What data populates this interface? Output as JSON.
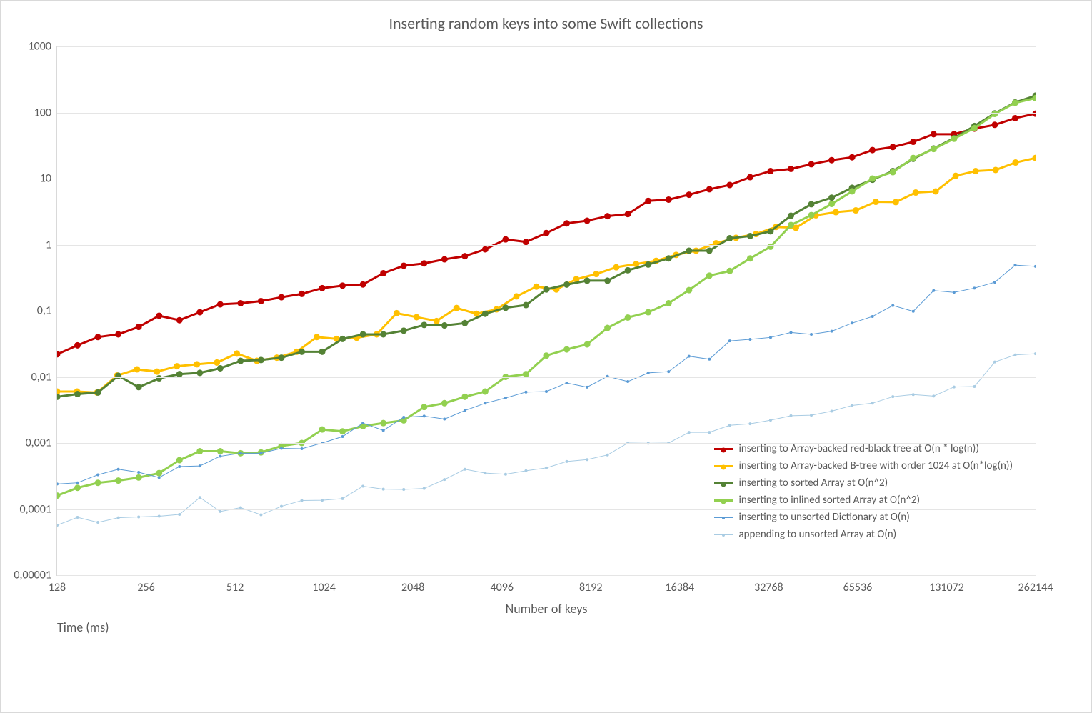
{
  "chart_data": {
    "type": "line",
    "title": "Inserting random keys into some Swift collections",
    "xlabel": "Number of keys",
    "ylabel": "Time (ms)",
    "x_scale": "log2",
    "y_scale": "log10",
    "x_ticks": [
      128,
      256,
      512,
      1024,
      2048,
      4096,
      8192,
      16384,
      32768,
      65536,
      131072,
      262144
    ],
    "y_ticks_values": [
      1e-05,
      0.0001,
      0.001,
      0.01,
      0.1,
      1,
      10,
      100,
      1000
    ],
    "y_ticks_labels": [
      "0,00001",
      "0,0001",
      "0,001",
      "0,01",
      "0,1",
      "1",
      "10",
      "100",
      "1000"
    ],
    "ylim": [
      1e-05,
      1000
    ],
    "xlim": [
      128,
      262144
    ],
    "legend_position": "inside-bottom-right",
    "series": [
      {
        "name": "inserting to Array-backed red-black tree at O(n * log(n))",
        "color": "#C00000",
        "weight": 3,
        "values": [
          0.022,
          0.03,
          0.04,
          0.044,
          0.057,
          0.084,
          0.072,
          0.095,
          0.125,
          0.13,
          0.14,
          0.16,
          0.18,
          0.22,
          0.24,
          0.25,
          0.37,
          0.48,
          0.52,
          0.6,
          0.67,
          0.85,
          1.2,
          1.1,
          1.5,
          2.1,
          2.3,
          2.7,
          2.9,
          4.6,
          4.8,
          5.7,
          6.9,
          8.0,
          10.5,
          13.0,
          14.0,
          16.5,
          19,
          21,
          27,
          30,
          36,
          47,
          47,
          57,
          65,
          82,
          96
        ]
      },
      {
        "name": "inserting to Array-backed B-tree with order 1024 at O(n*log(n))",
        "color": "#FFC000",
        "weight": 3,
        "values": [
          0.006,
          0.006,
          0.0058,
          0.0105,
          0.013,
          0.012,
          0.0145,
          0.0155,
          0.0165,
          0.0225,
          0.0175,
          0.0195,
          0.024,
          0.04,
          0.0375,
          0.039,
          0.044,
          0.092,
          0.08,
          0.07,
          0.11,
          0.09,
          0.105,
          0.165,
          0.232,
          0.21,
          0.3,
          0.36,
          0.455,
          0.51,
          0.57,
          0.7,
          0.81,
          1.05,
          1.27,
          1.45,
          1.85,
          1.8,
          2.78,
          3.1,
          3.3,
          4.45,
          4.41,
          6.15,
          6.39,
          11.0,
          13.0,
          13.5,
          17.5,
          20.5
        ]
      },
      {
        "name": "inserting to sorted Array at O(n^2)",
        "color": "#548235",
        "weight": 3,
        "values": [
          0.005,
          0.0055,
          0.0058,
          0.0104,
          0.007,
          0.0095,
          0.011,
          0.0115,
          0.0135,
          0.0175,
          0.018,
          0.0195,
          0.024,
          0.024,
          0.0375,
          0.044,
          0.044,
          0.05,
          0.061,
          0.06,
          0.065,
          0.09,
          0.111,
          0.122,
          0.21,
          0.249,
          0.285,
          0.285,
          0.41,
          0.5,
          0.62,
          0.81,
          0.81,
          1.25,
          1.35,
          1.59,
          2.74,
          4.09,
          5.14,
          7.25,
          9.6,
          13.0,
          19.9,
          28.5,
          41.0,
          62.5,
          97.0,
          142,
          180
        ]
      },
      {
        "name": "inserting to inlined sorted Array at O(n^2)",
        "color": "#92D050",
        "weight": 3,
        "values": [
          0.00016,
          0.00021,
          0.00025,
          0.00027,
          0.0003,
          0.00035,
          0.00055,
          0.00075,
          0.00075,
          0.0007,
          0.00072,
          0.0009,
          0.001,
          0.0016,
          0.0015,
          0.0018,
          0.002,
          0.0022,
          0.0035,
          0.004,
          0.005,
          0.006,
          0.01,
          0.011,
          0.021,
          0.026,
          0.031,
          0.055,
          0.079,
          0.095,
          0.13,
          0.205,
          0.34,
          0.4,
          0.62,
          0.93,
          1.98,
          2.8,
          4.13,
          6.4,
          10.0,
          12.5,
          20.5,
          28.0,
          40.0,
          58.0,
          95.0,
          140,
          165
        ]
      },
      {
        "name": "inserting to unsorted Dictionary at O(n)",
        "color": "#5B9BD5",
        "weight": 1,
        "values": [
          0.00024,
          0.00025,
          0.00033,
          0.0004,
          0.00036,
          0.0003,
          0.00044,
          0.00045,
          0.00063,
          0.0007,
          0.0007,
          0.00083,
          0.00082,
          0.001,
          0.00125,
          0.002,
          0.00155,
          0.00245,
          0.00255,
          0.0023,
          0.0031,
          0.004,
          0.0048,
          0.0059,
          0.006,
          0.0081,
          0.007,
          0.0102,
          0.0085,
          0.0115,
          0.012,
          0.0205,
          0.0185,
          0.035,
          0.037,
          0.0395,
          0.047,
          0.044,
          0.049,
          0.065,
          0.082,
          0.12,
          0.098,
          0.202,
          0.19,
          0.22,
          0.27,
          0.49,
          0.47
        ]
      },
      {
        "name": "appending to unsorted Array at O(n)",
        "color": "#A9CCE3",
        "weight": 1,
        "values": [
          5.7e-05,
          7.5e-05,
          6.3e-05,
          7.4e-05,
          7.6e-05,
          7.8e-05,
          8.3e-05,
          0.00015,
          9.2e-05,
          0.000105,
          8.2e-05,
          0.00011,
          0.000135,
          0.000136,
          0.000144,
          0.000222,
          0.0002,
          0.000198,
          0.000205,
          0.00028,
          0.0004,
          0.00035,
          0.000337,
          0.00038,
          0.00042,
          0.000525,
          0.00056,
          0.00066,
          0.001,
          0.00099,
          0.001,
          0.00145,
          0.00145,
          0.00185,
          0.00195,
          0.00221,
          0.00258,
          0.00263,
          0.00303,
          0.0037,
          0.004,
          0.00502,
          0.0054,
          0.00513,
          0.00704,
          0.00715,
          0.0168,
          0.0215,
          0.0224
        ]
      }
    ]
  }
}
